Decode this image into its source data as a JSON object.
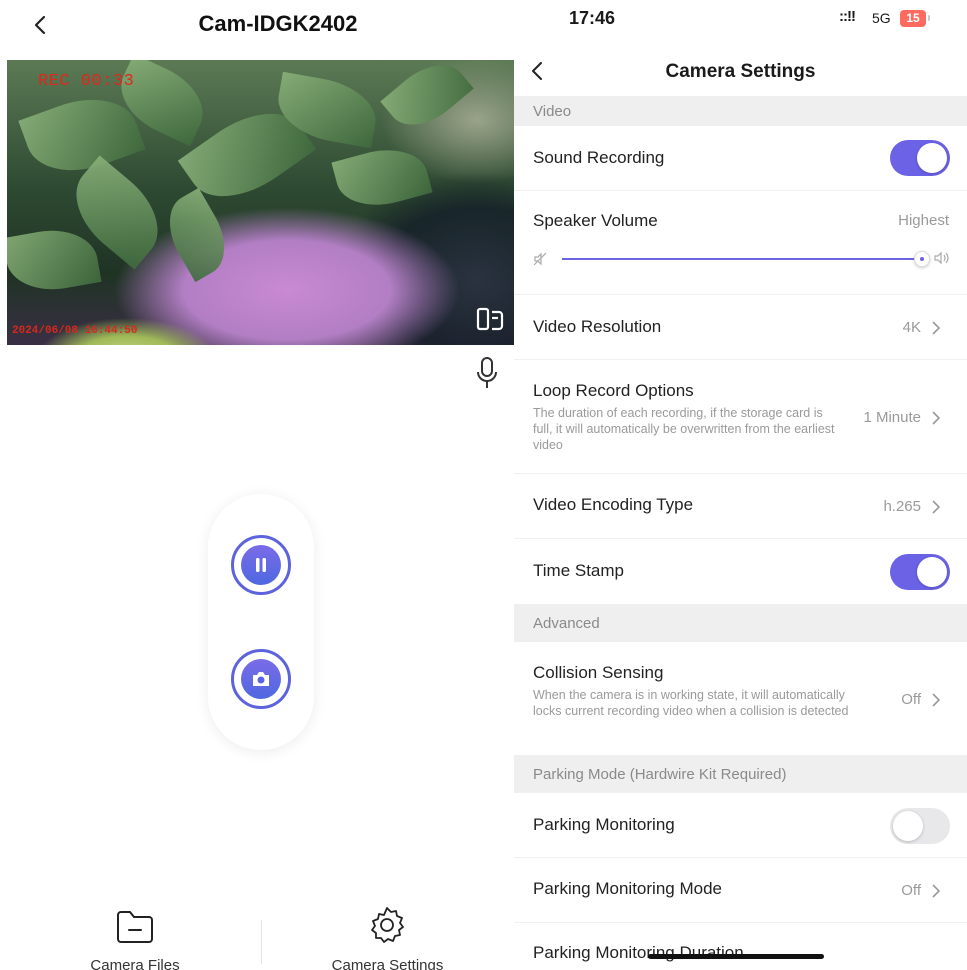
{
  "left": {
    "title": "Cam-IDGK2402",
    "video": {
      "rec_text": "REC  00:33",
      "timestamp": "2024/06/08  16:44:50"
    },
    "tabs": [
      {
        "label": "Camera Files",
        "icon": "folder-icon"
      },
      {
        "label": "Camera Settings",
        "icon": "gear-icon"
      }
    ]
  },
  "status": {
    "time": "17:46",
    "signal": "::!!",
    "network": "5G",
    "battery": "15"
  },
  "settings": {
    "title": "Camera Settings",
    "sections": {
      "video": "Video",
      "advanced": "Advanced",
      "parking": "Parking Mode (Hardwire Kit Required)"
    },
    "sound_recording": {
      "label": "Sound Recording",
      "on": true
    },
    "speaker_volume": {
      "label": "Speaker Volume",
      "value": "Highest",
      "level": 1.0
    },
    "video_resolution": {
      "label": "Video Resolution",
      "value": "4K"
    },
    "loop_record": {
      "label": "Loop Record Options",
      "desc": "The duration of each recording, if the storage card is full, it will automatically be overwritten from the earliest video",
      "value": "1 Minute"
    },
    "encoding": {
      "label": "Video Encoding Type",
      "value": "h.265"
    },
    "time_stamp": {
      "label": "Time Stamp",
      "on": true
    },
    "collision": {
      "label": "Collision Sensing",
      "desc": "When the camera is in working state, it will automatically locks current recording video when a collision is detected",
      "value": "Off"
    },
    "parking_monitoring": {
      "label": "Parking Monitoring",
      "on": false
    },
    "parking_mode": {
      "label": "Parking Monitoring Mode",
      "value": "Off"
    },
    "parking_duration": {
      "label": "Parking Monitoring Duration"
    },
    "colors": {
      "accent": "#6b62e6",
      "section_bg": "#efeff0"
    }
  }
}
